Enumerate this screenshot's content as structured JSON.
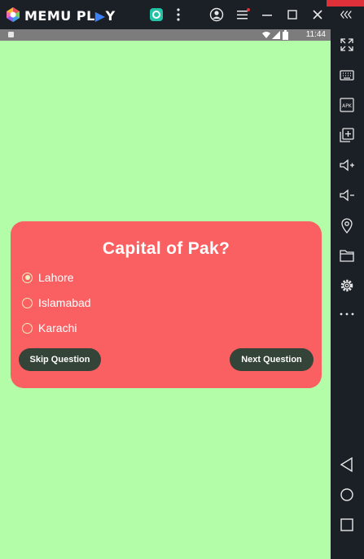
{
  "emulator": {
    "brand_left": "MEMU PL",
    "brand_play": "▶",
    "brand_right": "Y",
    "accent_color": "#3b82f6"
  },
  "status_bar": {
    "time": "11:44"
  },
  "quiz": {
    "question": "Capital of Pak?",
    "options": [
      {
        "label": "Lahore",
        "selected": true
      },
      {
        "label": "Islamabad",
        "selected": false
      },
      {
        "label": "Karachi",
        "selected": false
      }
    ],
    "skip_label": "Skip Question",
    "next_label": "Next Question"
  },
  "colors": {
    "background": "#b3fca8",
    "card": "#fa5f61",
    "button": "#344438",
    "radio": "#e9f2c2"
  },
  "sidebar_icons": [
    "fullscreen-icon",
    "keyboard-icon",
    "apk-icon",
    "add-window-icon",
    "volume-up-icon",
    "volume-down-icon",
    "location-icon",
    "folder-icon",
    "settings-icon",
    "more-icon",
    "back-icon",
    "home-icon",
    "recents-icon"
  ]
}
